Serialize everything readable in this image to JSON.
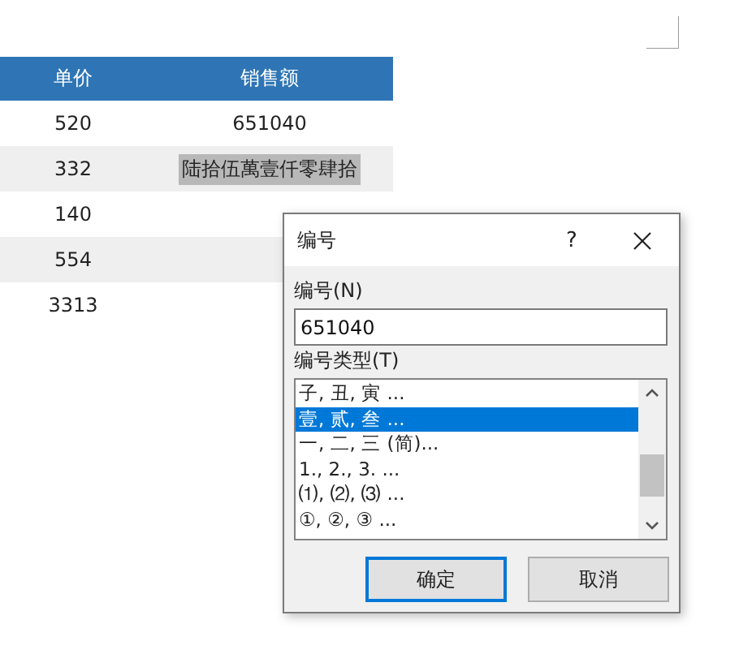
{
  "table": {
    "columns": [
      "单价",
      "销售额"
    ],
    "rows": [
      {
        "cells": [
          {
            "text": "520",
            "selected": false
          },
          {
            "text": "651040",
            "selected": false
          }
        ]
      },
      {
        "cells": [
          {
            "text": "332",
            "selected": false
          },
          {
            "text": "陆拾伍萬壹仟零肆拾",
            "selected": true
          }
        ]
      },
      {
        "cells": [
          {
            "text": "140",
            "selected": false
          }
        ]
      },
      {
        "cells": [
          {
            "text": "554",
            "selected": false
          }
        ]
      },
      {
        "cells": [
          {
            "text": "3313",
            "selected": false
          }
        ]
      }
    ]
  },
  "dialog": {
    "title": "编号",
    "help": "?",
    "number_label": "编号(N)",
    "number_value": "651040",
    "type_label": "编号类型(T)",
    "types": [
      {
        "label": "子, 丑, 寅 ...",
        "selected": false
      },
      {
        "label": "壹, 贰, 叁 ...",
        "selected": true
      },
      {
        "label": "一, 二, 三 (简)...",
        "selected": false
      },
      {
        "label": "1., 2., 3. ...",
        "selected": false
      },
      {
        "label": "⑴, ⑵, ⑶ ...",
        "selected": false
      },
      {
        "label": "①, ②, ③ ...",
        "selected": false
      }
    ],
    "buttons": [
      {
        "label": "确定",
        "default": true
      },
      {
        "label": "取消",
        "default": false
      }
    ]
  }
}
